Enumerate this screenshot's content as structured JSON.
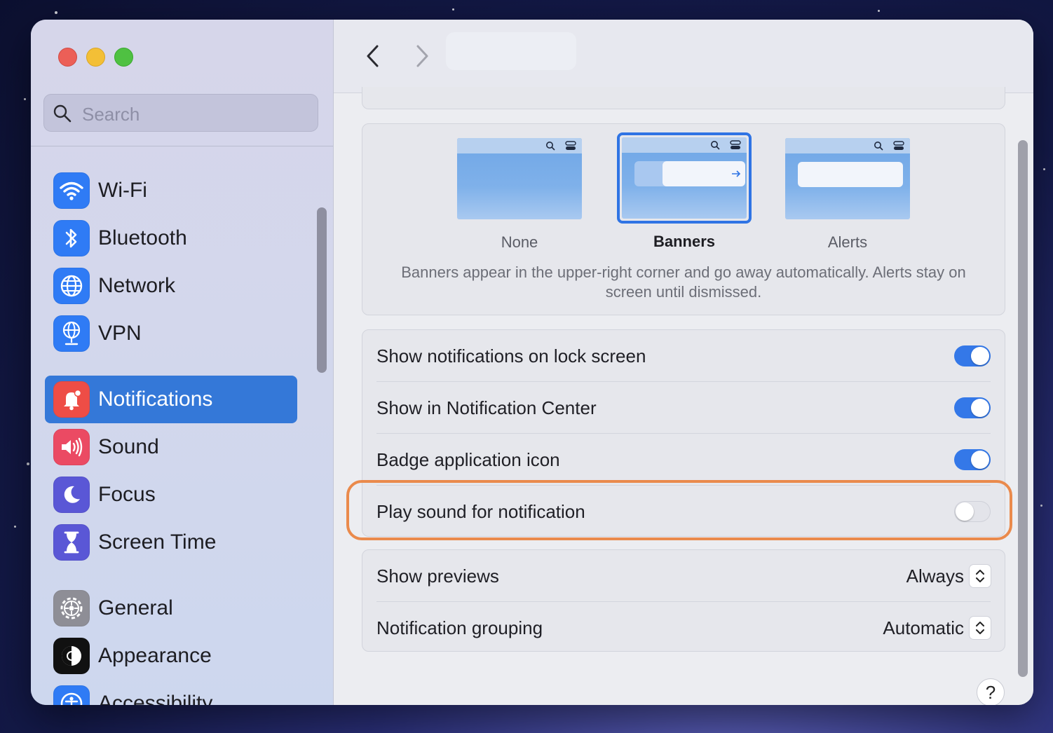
{
  "sidebar": {
    "search_placeholder": "Search",
    "items": [
      {
        "label": "Wi-Fi"
      },
      {
        "label": "Bluetooth"
      },
      {
        "label": "Network"
      },
      {
        "label": "VPN"
      },
      {
        "label": "Notifications"
      },
      {
        "label": "Sound"
      },
      {
        "label": "Focus"
      },
      {
        "label": "Screen Time"
      },
      {
        "label": "General"
      },
      {
        "label": "Appearance"
      },
      {
        "label": "Accessibility"
      }
    ],
    "active_item": "Notifications"
  },
  "alert_style": {
    "options": [
      {
        "label": "None",
        "selected": false
      },
      {
        "label": "Banners",
        "selected": true
      },
      {
        "label": "Alerts",
        "selected": false
      }
    ],
    "description": "Banners appear in the upper-right corner and go away automatically. Alerts stay on screen until dismissed."
  },
  "toggles": [
    {
      "label": "Show notifications on lock screen",
      "on": true
    },
    {
      "label": "Show in Notification Center",
      "on": true
    },
    {
      "label": "Badge application icon",
      "on": true
    },
    {
      "label": "Play sound for notification",
      "on": false
    }
  ],
  "selects": [
    {
      "label": "Show previews",
      "value": "Always"
    },
    {
      "label": "Notification grouping",
      "value": "Automatic"
    }
  ],
  "help_label": "?",
  "colors": {
    "accent": "#3478e8",
    "highlight": "#ea8a4c",
    "sidebar_active": "#3478d8"
  }
}
